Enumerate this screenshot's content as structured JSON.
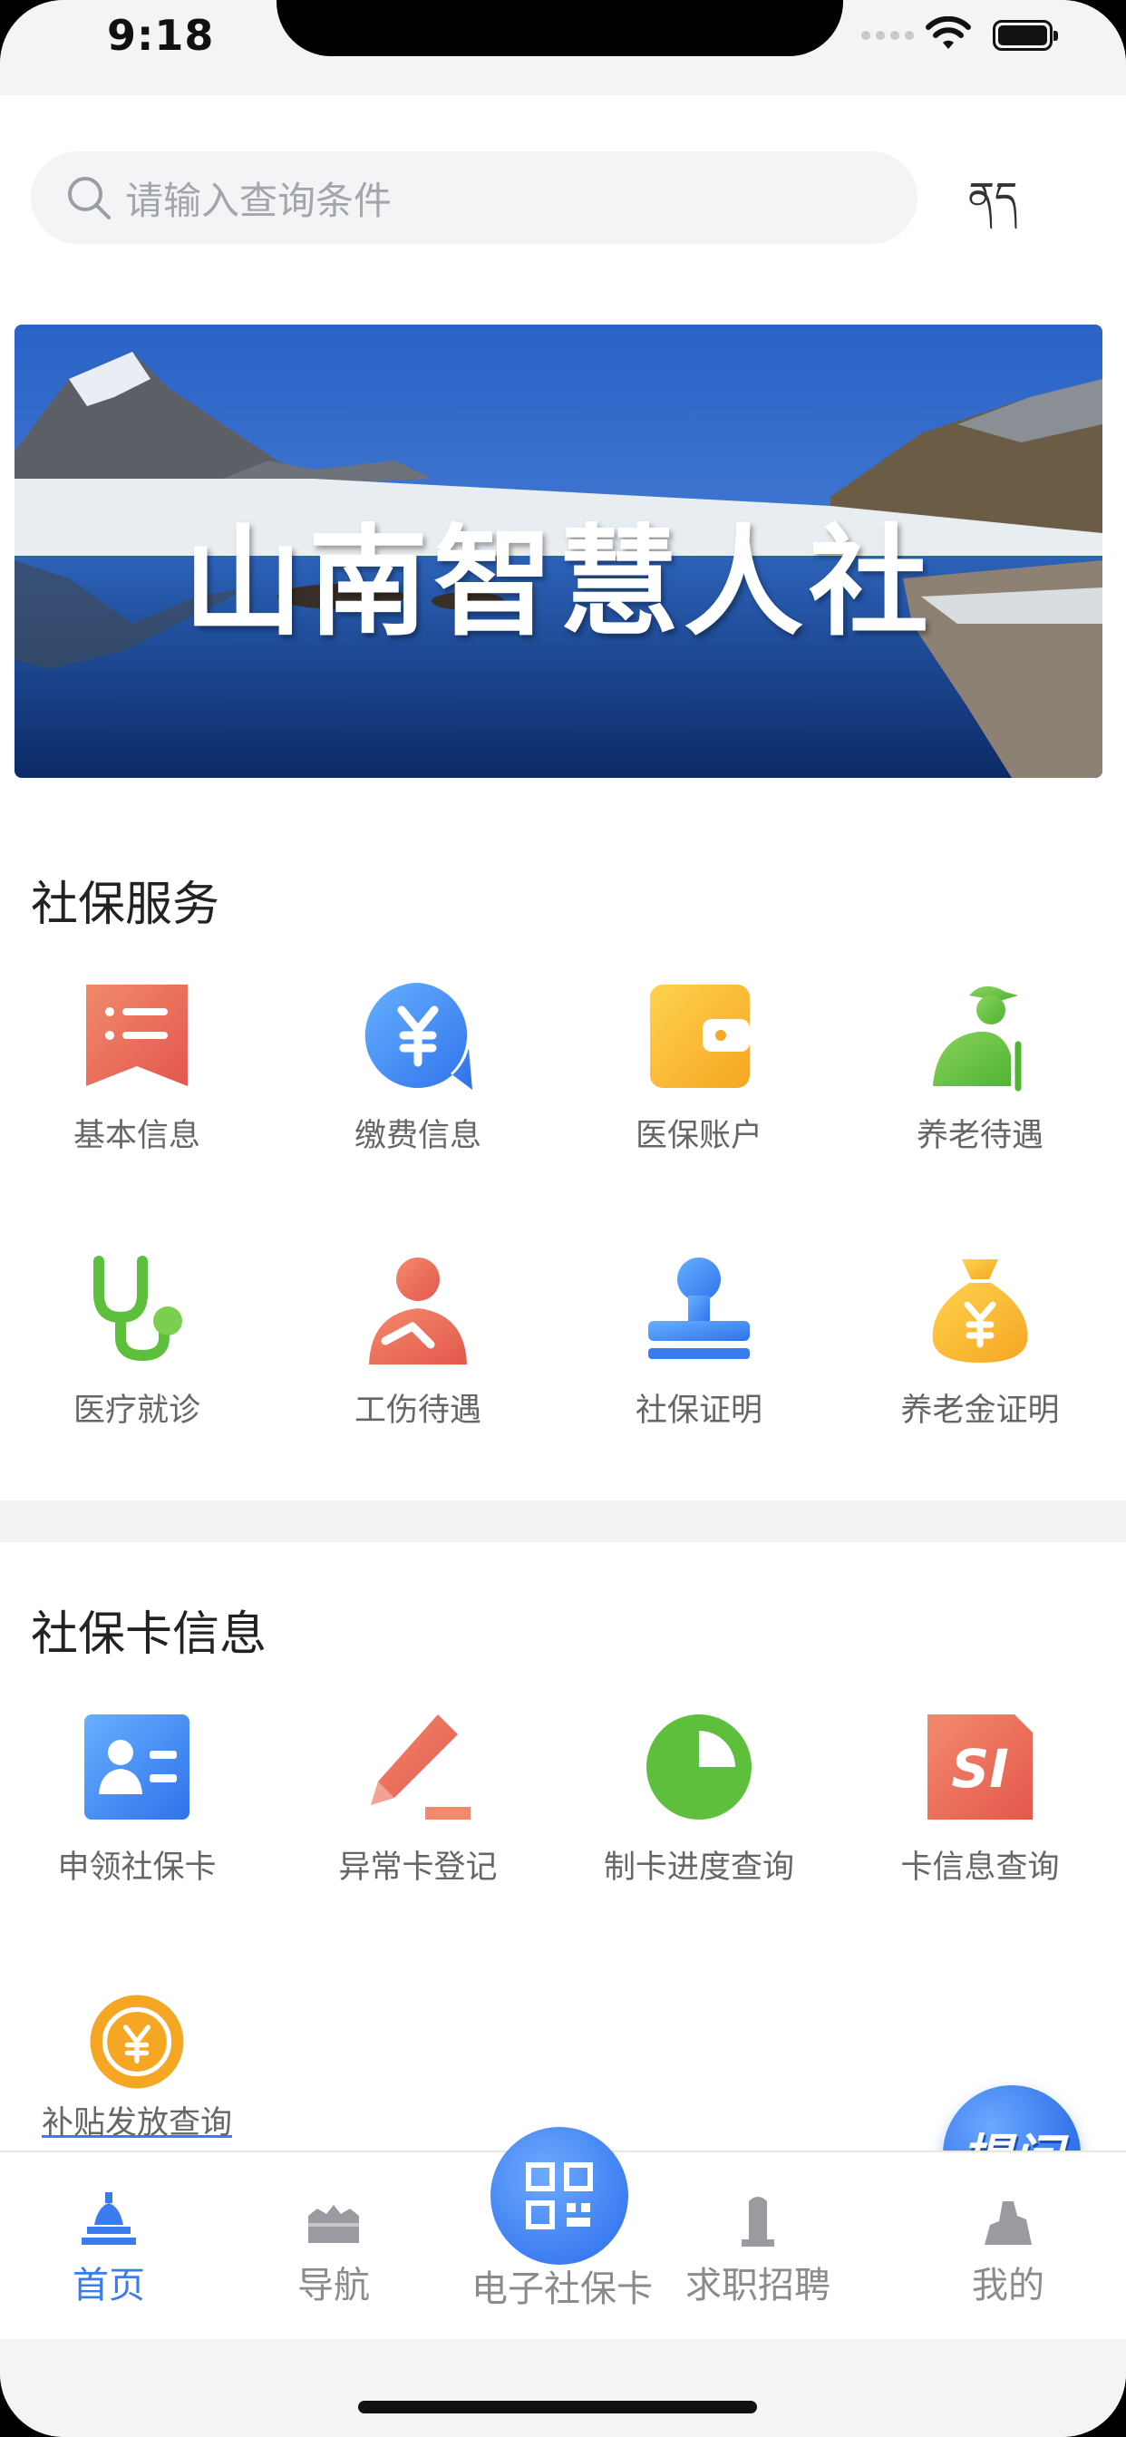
{
  "status_bar": {
    "time": "9:18"
  },
  "search": {
    "placeholder": "请输入查询条件"
  },
  "language_toggle": "ནད",
  "banner": {
    "title": "山南智慧人社"
  },
  "social_services": {
    "title": "社保服务",
    "items": [
      {
        "label": "基本信息",
        "icon": "info-list-icon"
      },
      {
        "label": "缴费信息",
        "icon": "yuan-coin-icon"
      },
      {
        "label": "医保账户",
        "icon": "wallet-icon"
      },
      {
        "label": "养老待遇",
        "icon": "elderly-person-icon"
      },
      {
        "label": "医疗就诊",
        "icon": "stethoscope-icon"
      },
      {
        "label": "工伤待遇",
        "icon": "injured-person-icon"
      },
      {
        "label": "社保证明",
        "icon": "stamp-icon"
      },
      {
        "label": "养老金证明",
        "icon": "money-bag-icon"
      }
    ]
  },
  "card_info": {
    "title": "社保卡信息",
    "items": [
      {
        "label": "申领社保卡",
        "icon": "id-card-icon"
      },
      {
        "label": "异常卡登记",
        "icon": "pen-edit-icon"
      },
      {
        "label": "制卡进度查询",
        "icon": "progress-pie-icon"
      },
      {
        "label": "卡信息查询",
        "icon": "si-card-icon"
      },
      {
        "label": "补贴发放查询",
        "icon": "subsidy-coin-icon"
      }
    ]
  },
  "float_button": {
    "label": "提问"
  },
  "tabbar": {
    "items": [
      {
        "label": "首页",
        "active": true
      },
      {
        "label": "导航",
        "active": false
      },
      {
        "label": "电子社保卡",
        "active": false
      },
      {
        "label": "求职招聘",
        "active": false
      },
      {
        "label": "我的",
        "active": false
      }
    ]
  },
  "colors": {
    "accent": "#3a7bf0",
    "red": "#ec6a54",
    "orange": "#f5b33a",
    "green": "#7ac943"
  }
}
